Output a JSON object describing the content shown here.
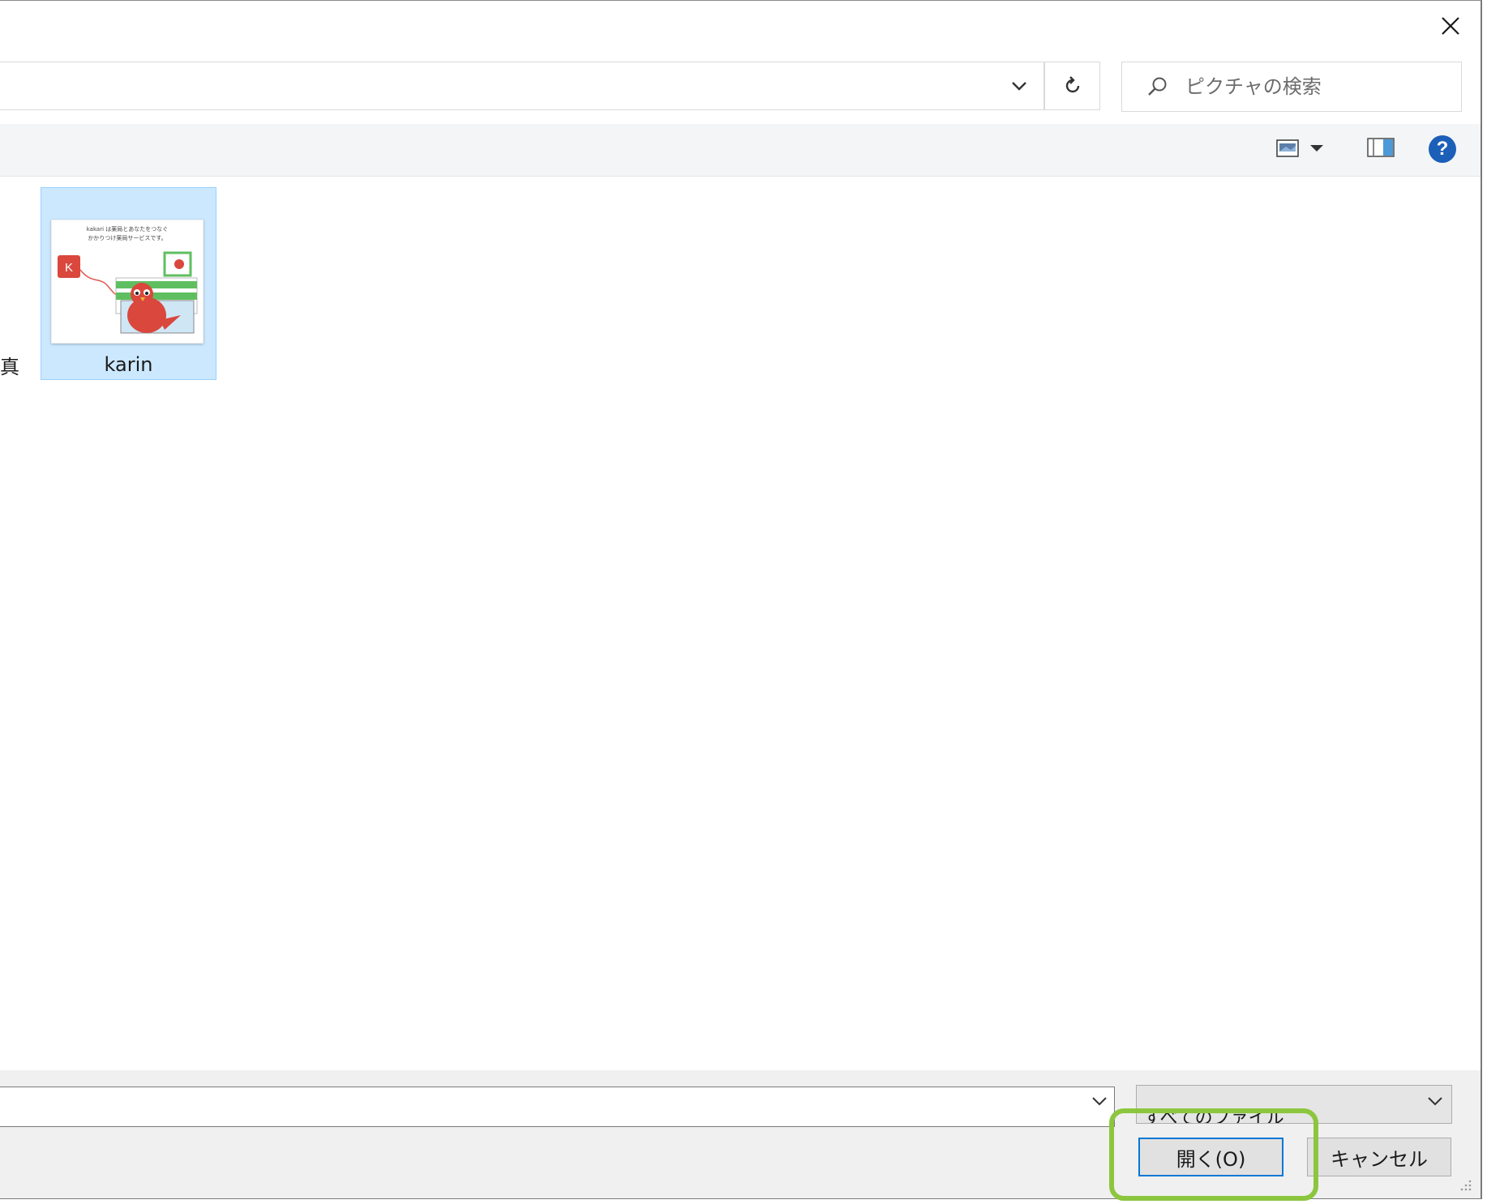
{
  "window": {
    "close_label": "×"
  },
  "search": {
    "placeholder": "ピクチャの検索"
  },
  "content": {
    "partial_label": "真",
    "items": [
      {
        "label": "karin",
        "thumbnail_caption_1": "kakari は薬局とあなたをつなぐ",
        "thumbnail_caption_2": "かかりつけ薬局サービスです。",
        "thumbnail_badge": "K"
      }
    ]
  },
  "bottom": {
    "filename_value": "",
    "filetype_value": "すべてのファイル",
    "open_label": "開く(O)",
    "cancel_label": "キャンセル"
  },
  "colors": {
    "selection_bg": "#cce8ff",
    "selection_border": "#99d1ff",
    "help_icon": "#1c5fb8",
    "highlight_annotation": "#8cc63f",
    "primary_button_border": "#0078d7"
  }
}
